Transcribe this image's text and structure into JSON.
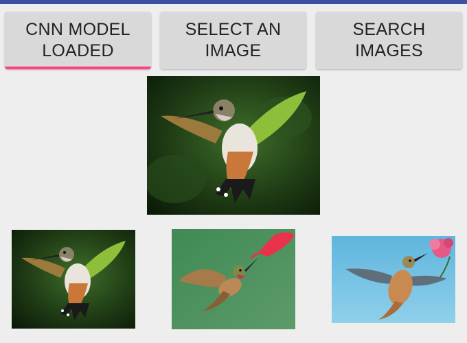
{
  "buttons": {
    "model": {
      "line1": "CNN MODEL",
      "line2": "LOADED"
    },
    "select": {
      "line1": "SELECT AN",
      "line2": "IMAGE"
    },
    "search": {
      "line1": "SEARCH",
      "line2": "IMAGES"
    }
  },
  "colors": {
    "status_bar": "#3f4fa3",
    "button_bg": "#d9d9d9",
    "accent_underline": "#ff4081",
    "background": "#eeeeee"
  },
  "images": {
    "query": {
      "subject": "hummingbird",
      "icon": "hummingbird-photo"
    },
    "results": [
      {
        "subject": "hummingbird",
        "icon": "hummingbird-photo"
      },
      {
        "subject": "hummingbird at feeder",
        "icon": "hummingbird-photo"
      },
      {
        "subject": "hummingbird with flower",
        "icon": "hummingbird-photo"
      }
    ]
  }
}
